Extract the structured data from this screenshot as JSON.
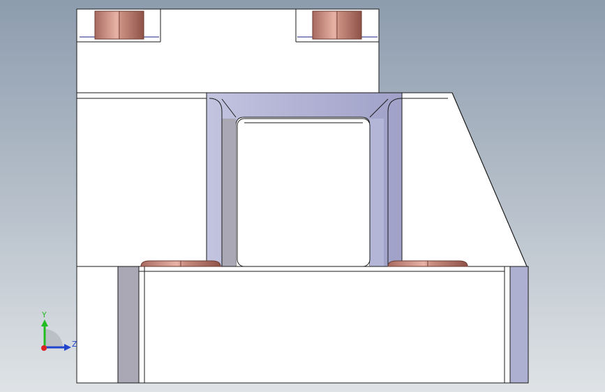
{
  "viewport": {
    "background_top": "#8d9cae",
    "background_bottom": "#dfe3e6"
  },
  "model": {
    "face_color": "#ffffff",
    "edge_color": "#1a1a1a",
    "fillet_color": "#aeb0d2",
    "side_face_color": "#a9a8b4",
    "pin_color": "#c98d80"
  },
  "triad": {
    "y_label": "Y",
    "z_label": "Z",
    "y_color": "#22bb22",
    "z_color": "#2244cc",
    "x_color": "#dd2222",
    "icons": [
      "axis-y-arrow",
      "axis-z-arrow",
      "origin-sphere"
    ]
  }
}
